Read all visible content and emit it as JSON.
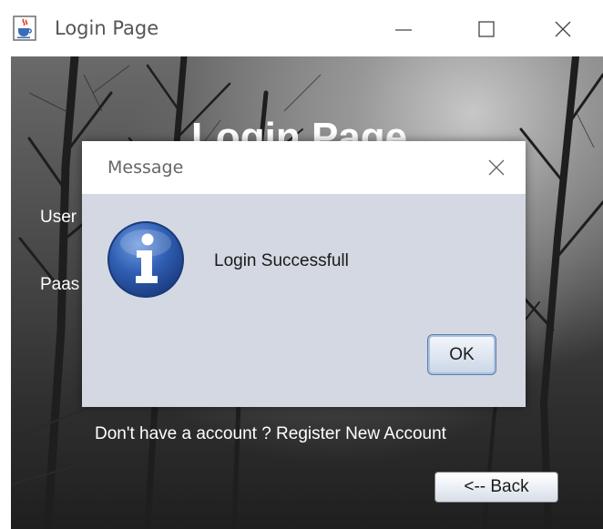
{
  "window": {
    "title": "Login Page",
    "icon": "java-cup-icon"
  },
  "background": {
    "heading": "Login Page",
    "username_label": "User",
    "password_label": "Paas",
    "register_text": "Don't have a account ? Register New Account",
    "back_button_label": "<-- Back"
  },
  "dialog": {
    "title": "Message",
    "icon": "info-icon",
    "message": "Login Successfull",
    "ok_label": "OK"
  },
  "colors": {
    "dialog_body": "#d4d8e2",
    "info_icon_blue": "#2f5fb3",
    "ok_border": "#5c7ea8"
  }
}
